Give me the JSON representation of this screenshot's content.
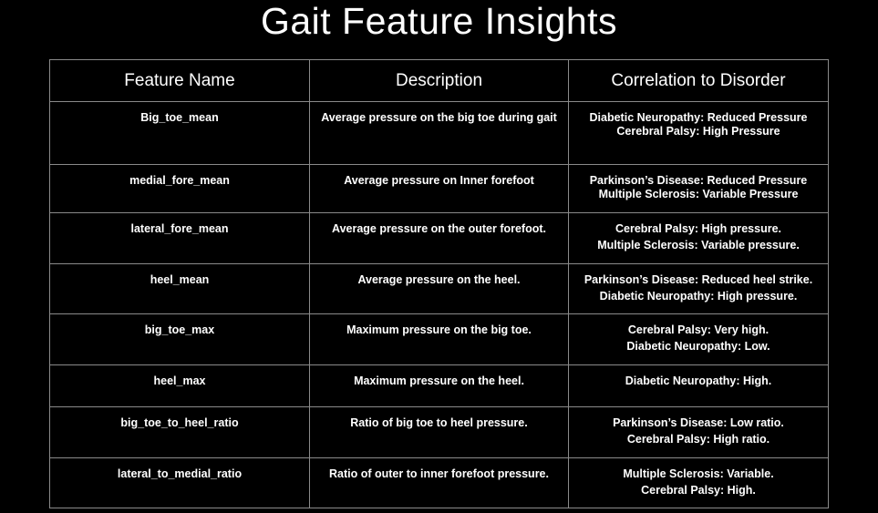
{
  "page": {
    "title": "Gait Feature Insights"
  },
  "table": {
    "headers": [
      "Feature Name",
      "Description",
      "Correlation to Disorder"
    ],
    "rows": [
      {
        "feature": "Big_toe_mean",
        "description": "Average pressure on the big toe during gait",
        "correlation": [
          "Diabetic Neuropathy: Reduced Pressure",
          "Cerebral Palsy: High Pressure"
        ]
      },
      {
        "feature": "medial_fore_mean",
        "description": "Average pressure on Inner forefoot",
        "correlation": [
          "Parkinson’s Disease: Reduced Pressure",
          "Multiple Sclerosis: Variable Pressure"
        ]
      },
      {
        "feature": "lateral_fore_mean",
        "description": "Average pressure on the outer forefoot.",
        "correlation": [
          "Cerebral Palsy: High pressure.",
          "Multiple Sclerosis: Variable pressure."
        ]
      },
      {
        "feature": "heel_mean",
        "description": "Average pressure on the heel.",
        "correlation": [
          "Parkinson’s Disease: Reduced heel strike.",
          "Diabetic Neuropathy: High pressure."
        ]
      },
      {
        "feature": "big_toe_max",
        "description": "Maximum pressure on the big toe.",
        "correlation": [
          "Cerebral Palsy: Very high.",
          "Diabetic Neuropathy: Low."
        ]
      },
      {
        "feature": "heel_max",
        "description": "Maximum pressure on the heel.",
        "correlation": [
          "Diabetic Neuropathy: High."
        ]
      },
      {
        "feature": "big_toe_to_heel_ratio",
        "description": "Ratio of big toe to heel pressure.",
        "correlation": [
          "Parkinson’s Disease: Low ratio.",
          "Cerebral Palsy: High ratio."
        ]
      },
      {
        "feature": "lateral_to_medial_ratio",
        "description": "Ratio of outer to inner forefoot pressure.",
        "correlation": [
          "Multiple Sclerosis: Variable.",
          "Cerebral Palsy: High."
        ]
      }
    ]
  }
}
